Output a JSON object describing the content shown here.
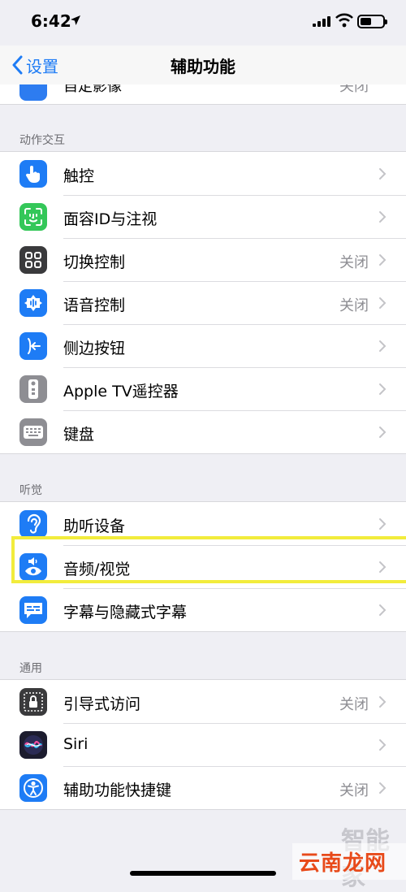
{
  "status_bar": {
    "time": "6:42"
  },
  "nav": {
    "back_label": "设置",
    "title": "辅助功能"
  },
  "partial_row": {
    "label": "自定影像",
    "value": "关闭"
  },
  "sections": {
    "interaction": {
      "header": "动作交互",
      "items": [
        {
          "label": "触控",
          "value": "",
          "icon": "touch-hand-icon",
          "color": "#1e7cf5"
        },
        {
          "label": "面容ID与注视",
          "value": "",
          "icon": "face-id-icon",
          "color": "#34c759"
        },
        {
          "label": "切换控制",
          "value": "关闭",
          "icon": "switch-control-grid-icon",
          "color": "#3a3a3c"
        },
        {
          "label": "语音控制",
          "value": "关闭",
          "icon": "voice-control-icon",
          "color": "#1e7cf5"
        },
        {
          "label": "侧边按钮",
          "value": "",
          "icon": "side-button-icon",
          "color": "#1e7cf5"
        },
        {
          "label": "Apple TV遥控器",
          "value": "",
          "icon": "tv-remote-icon",
          "color": "#8e8e93"
        },
        {
          "label": "键盘",
          "value": "",
          "icon": "keyboard-icon",
          "color": "#8e8e93"
        }
      ]
    },
    "hearing": {
      "header": "听觉",
      "items": [
        {
          "label": "助听设备",
          "value": "",
          "icon": "ear-icon",
          "color": "#1e7cf5"
        },
        {
          "label": "音频/视觉",
          "value": "",
          "icon": "audio-visual-icon",
          "color": "#1e7cf5"
        },
        {
          "label": "字幕与隐藏式字幕",
          "value": "",
          "icon": "subtitles-icon",
          "color": "#1e7cf5"
        }
      ]
    },
    "general": {
      "header": "通用",
      "items": [
        {
          "label": "引导式访问",
          "value": "关闭",
          "icon": "guided-access-lock-icon",
          "color": "#3a3a3c"
        },
        {
          "label": "Siri",
          "value": "",
          "icon": "siri-icon",
          "color": "#1c1c2e"
        },
        {
          "label": "辅助功能快捷键",
          "value": "关闭",
          "icon": "accessibility-icon",
          "color": "#1e7cf5"
        }
      ]
    }
  },
  "watermark": {
    "faded": "智能家",
    "text": "云南龙网"
  }
}
